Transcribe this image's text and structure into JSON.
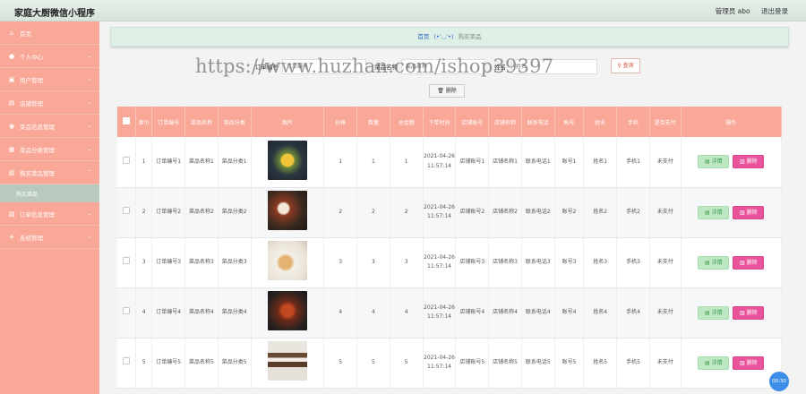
{
  "header": {
    "app_title": "家庭大厨微信小程序",
    "admin_label": "管理员 abo",
    "logout_label": "退出登录"
  },
  "sidebar": {
    "items": [
      {
        "label": "首页",
        "icon": "home-icon"
      },
      {
        "label": "个人中心",
        "icon": "user-icon"
      },
      {
        "label": "用户管理",
        "icon": "users-icon"
      },
      {
        "label": "店铺管理",
        "icon": "shop-icon"
      },
      {
        "label": "菜品信息管理",
        "icon": "dish-info-icon"
      },
      {
        "label": "菜品分类管理",
        "icon": "category-icon"
      },
      {
        "label": "购买菜品管理",
        "icon": "cart-icon"
      },
      {
        "label": "订单信息管理",
        "icon": "order-icon"
      },
      {
        "label": "系统管理",
        "icon": "system-icon"
      }
    ],
    "active_sub_item": "购买菜品"
  },
  "breadcrumb": {
    "home": "首页",
    "separator": "(•'◡'•)",
    "current": "购买菜品"
  },
  "search": {
    "field1_label": "订单编号",
    "field1_placeholder": "订单编号",
    "field2_label": "菜品名称",
    "field2_placeholder": "菜品名称",
    "field3_label": "姓名",
    "field3_placeholder": "姓名",
    "query_label": "查询",
    "batch_delete_label": "删除"
  },
  "watermark": "https://www.huzhan.com/ishop39397",
  "table": {
    "headers": [
      "索引",
      "订单编号",
      "菜品名称",
      "菜品分类",
      "图片",
      "价格",
      "数量",
      "总金额",
      "下单时间",
      "店铺账号",
      "店铺名称",
      "联系电话",
      "账号",
      "姓名",
      "手机",
      "是否支付",
      "操作"
    ],
    "detail_label": "详情",
    "delete_label": "删除",
    "rows": [
      {
        "index": "1",
        "order_no": "订单编号1",
        "dish_name": "菜品名称1",
        "dish_cat": "菜品分类1",
        "image": "dish-1",
        "price": "1",
        "qty": "1",
        "total": "1",
        "time": "2021-04-26 11:57:14",
        "shop_acct": "店铺账号1",
        "shop_name": "店铺名称1",
        "phone": "联系电话1",
        "acct": "账号1",
        "name": "姓名1",
        "mobile": "手机1",
        "paid": "未支付"
      },
      {
        "index": "2",
        "order_no": "订单编号2",
        "dish_name": "菜品名称2",
        "dish_cat": "菜品分类2",
        "image": "dish-2",
        "price": "2",
        "qty": "2",
        "total": "2",
        "time": "2021-04-26 11:57:14",
        "shop_acct": "店铺账号2",
        "shop_name": "店铺名称2",
        "phone": "联系电话2",
        "acct": "账号2",
        "name": "姓名2",
        "mobile": "手机2",
        "paid": "未支付"
      },
      {
        "index": "3",
        "order_no": "订单编号3",
        "dish_name": "菜品名称3",
        "dish_cat": "菜品分类3",
        "image": "dish-3",
        "price": "3",
        "qty": "3",
        "total": "3",
        "time": "2021-04-26 11:57:14",
        "shop_acct": "店铺账号3",
        "shop_name": "店铺名称3",
        "phone": "联系电话3",
        "acct": "账号3",
        "name": "姓名3",
        "mobile": "手机3",
        "paid": "未支付"
      },
      {
        "index": "4",
        "order_no": "订单编号4",
        "dish_name": "菜品名称4",
        "dish_cat": "菜品分类4",
        "image": "dish-4",
        "price": "4",
        "qty": "4",
        "total": "4",
        "time": "2021-04-26 11:57:14",
        "shop_acct": "店铺账号4",
        "shop_name": "店铺名称4",
        "phone": "联系电话4",
        "acct": "账号4",
        "name": "姓名4",
        "mobile": "手机4",
        "paid": "未支付"
      },
      {
        "index": "5",
        "order_no": "订单编号5",
        "dish_name": "菜品名称5",
        "dish_cat": "菜品分类5",
        "image": "dish-5",
        "price": "5",
        "qty": "5",
        "total": "5",
        "time": "2021-04-26 11:57:14",
        "shop_acct": "店铺账号5",
        "shop_name": "店铺名称5",
        "phone": "联系电话5",
        "acct": "账号5",
        "name": "姓名5",
        "mobile": "手机5",
        "paid": "未支付"
      }
    ]
  },
  "timer_badge": "00:30",
  "colors": {
    "sidebar_bg": "#f9a797",
    "header_bg": "#e6f0ea",
    "table_header": "#f9a797",
    "detail_button": "#bde8c3",
    "delete_button": "#e8539b",
    "link_blue": "#2c63c4"
  }
}
